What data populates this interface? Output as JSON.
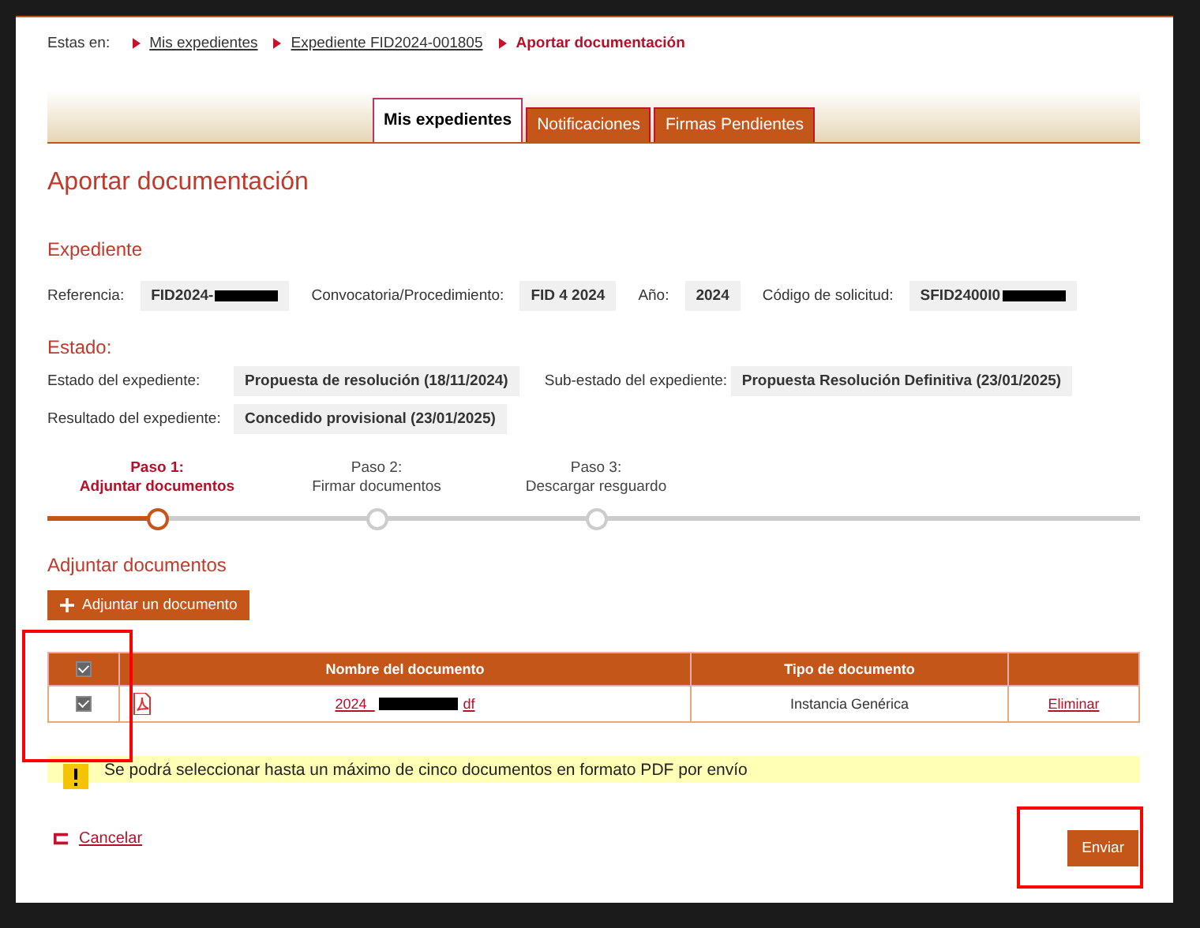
{
  "breadcrumb": {
    "label": "Estas en:",
    "items": [
      {
        "text": "Mis expedientes",
        "current": false
      },
      {
        "text": "Expediente FID2024-001805",
        "current": false
      },
      {
        "text": "Aportar documentación",
        "current": true
      }
    ]
  },
  "tabs": [
    {
      "label": "Mis expedientes",
      "selected": true
    },
    {
      "label": "Notificaciones",
      "selected": false
    },
    {
      "label": "Firmas Pendientes",
      "selected": false
    }
  ],
  "title": "Aportar documentación",
  "expediente": {
    "heading": "Expediente",
    "fields": [
      {
        "label": "Referencia:",
        "value": "FID2024-",
        "redacted": true
      },
      {
        "label": "Convocatoria/Procedimiento:",
        "value": "FID 4 2024",
        "redacted": false
      },
      {
        "label": "Año:",
        "value": "2024",
        "redacted": false
      },
      {
        "label": "Código de solicitud:",
        "value": "SFID2400I0",
        "redacted": true
      }
    ]
  },
  "estado": {
    "heading": "Estado:",
    "rows": [
      [
        {
          "label": "Estado del expediente:",
          "value": "Propuesta de resolución (18/11/2024)"
        },
        {
          "label": "Sub-estado del expediente:",
          "value": "Propuesta Resolución Definitiva (23/01/2025)"
        }
      ],
      [
        {
          "label": "Resultado del expediente:",
          "value": "Concedido provisional (23/01/2025)"
        }
      ]
    ]
  },
  "steps": [
    {
      "title": "Paso 1:",
      "label": "Adjuntar documentos",
      "selected": true
    },
    {
      "title": "Paso 2:",
      "label": "Firmar documentos",
      "selected": false
    },
    {
      "title": "Paso 3:",
      "label": "Descargar resguardo",
      "selected": false
    }
  ],
  "attach": {
    "heading": "Adjuntar documentos",
    "button": "Adjuntar un documento"
  },
  "table": {
    "header_checked": true,
    "columns": [
      "Nombre del documento",
      "Tipo de documento"
    ],
    "rows": [
      {
        "checked": true,
        "file_start": "2024_",
        "file_end": "df",
        "type": "Instancia Genérica",
        "action": "Eliminar"
      }
    ]
  },
  "notice": "Se podrá seleccionar hasta un máximo de cinco documentos en formato PDF por envío",
  "cancel": "Cancelar",
  "submit": "Enviar"
}
